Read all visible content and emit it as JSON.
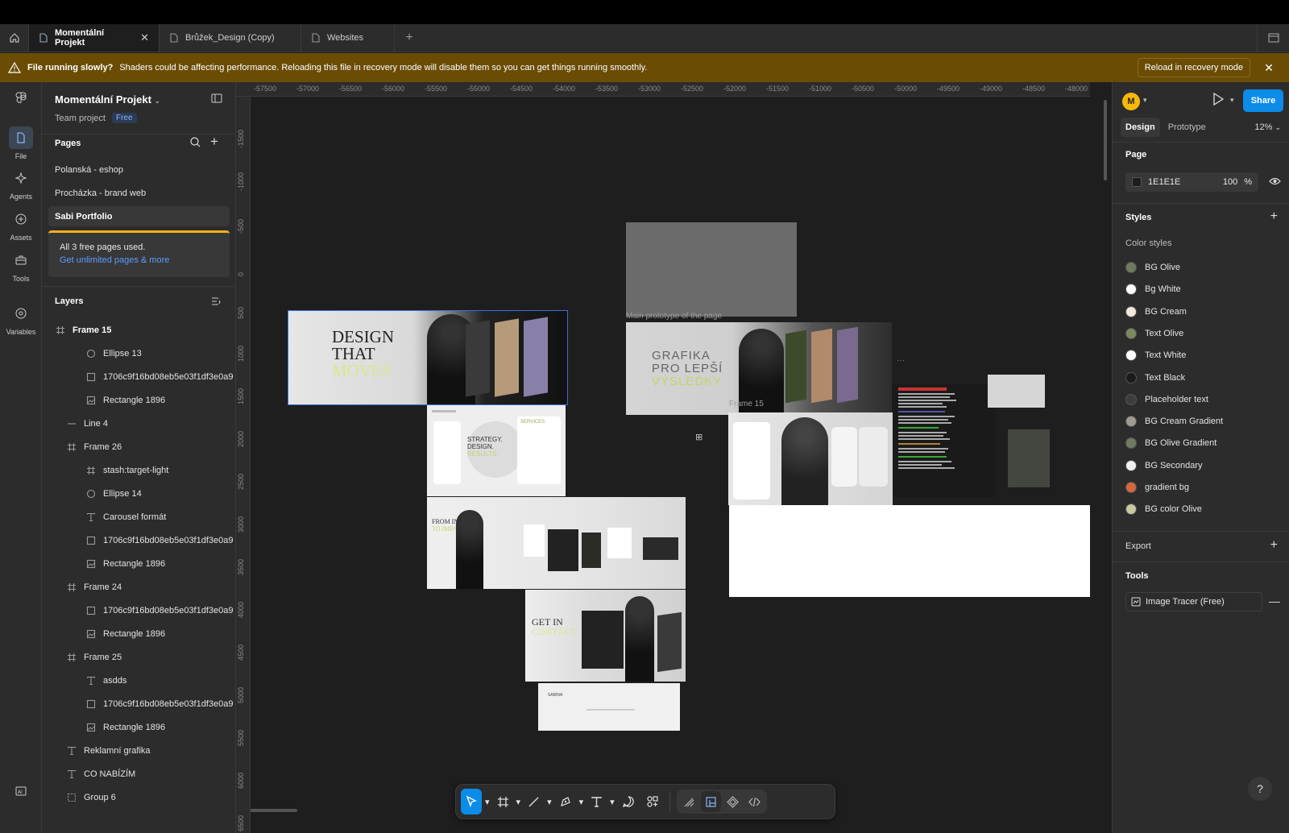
{
  "tabs": {
    "items": [
      {
        "label": "Momentální Projekt",
        "active": true
      },
      {
        "label": "Brůžek_Design (Copy)",
        "active": false
      },
      {
        "label": "Websites",
        "active": false
      }
    ]
  },
  "banner": {
    "title": "File running slowly?",
    "message": "Shaders could be affecting performance. Reloading this file in recovery mode will disable them so you can get things running smoothly.",
    "button": "Reload in recovery mode"
  },
  "rail": {
    "items": [
      {
        "label": "File",
        "icon": "file-icon"
      },
      {
        "label": "Agents",
        "icon": "agents-icon"
      },
      {
        "label": "Assets",
        "icon": "assets-icon"
      },
      {
        "label": "Tools",
        "icon": "tools-icon"
      },
      {
        "label": "Variables",
        "icon": "variables-icon"
      }
    ]
  },
  "project": {
    "name": "Momentální Projekt",
    "team": "Team project",
    "plan": "Free"
  },
  "pages": {
    "title": "Pages",
    "items": [
      "Polanská - eshop",
      "Procházka - brand web",
      "Sabi Portfolio"
    ],
    "notice_text": "All 3 free pages used.",
    "notice_link": "Get unlimited pages & more"
  },
  "layers": {
    "title": "Layers",
    "items": [
      {
        "name": "Frame 15",
        "type": "frame",
        "bold": true
      },
      {
        "name": "Ellipse 13",
        "type": "ellipse"
      },
      {
        "name": "1706c9f16bd08eb5e03f1df3e0a9",
        "type": "rect"
      },
      {
        "name": "Rectangle 1896",
        "type": "image"
      },
      {
        "name": "Line 4",
        "type": "line"
      },
      {
        "name": "Frame 26",
        "type": "frame"
      },
      {
        "name": "stash:target-light",
        "type": "frame"
      },
      {
        "name": "Ellipse 14",
        "type": "ellipse"
      },
      {
        "name": "Carousel formát",
        "type": "text"
      },
      {
        "name": "1706c9f16bd08eb5e03f1df3e0a9",
        "type": "rect"
      },
      {
        "name": "Rectangle 1896",
        "type": "image"
      },
      {
        "name": "Frame 24",
        "type": "frame"
      },
      {
        "name": "1706c9f16bd08eb5e03f1df3e0a9",
        "type": "rect"
      },
      {
        "name": "Rectangle 1896",
        "type": "image"
      },
      {
        "name": "Frame 25",
        "type": "frame"
      },
      {
        "name": "asdds",
        "type": "text"
      },
      {
        "name": "1706c9f16bd08eb5e03f1df3e0a9",
        "type": "rect"
      },
      {
        "name": "Rectangle 1896",
        "type": "image"
      },
      {
        "name": "Reklamní grafika",
        "type": "text"
      },
      {
        "name": "CO NABÍZÍM",
        "type": "text"
      },
      {
        "name": "Group 6",
        "type": "group"
      }
    ]
  },
  "ruler": {
    "top": [
      "-57500",
      "-57000",
      "-56500",
      "-56000",
      "-55500",
      "-55000",
      "-54500",
      "-54000",
      "-53500",
      "-53000",
      "-52500",
      "-52000",
      "-51500",
      "-51000",
      "-50500",
      "-50000",
      "-49500",
      "-49000",
      "-48500",
      "-48000"
    ],
    "left": [
      "-1500",
      "-1000",
      "-500",
      "0",
      "500",
      "1000",
      "1500",
      "2000",
      "2500",
      "3000",
      "3500",
      "4000",
      "4500",
      "5000",
      "5500",
      "6000",
      "6500"
    ]
  },
  "canvas": {
    "label_main_prototype": "Main prototype of the page",
    "label_frame15": "Frame 15",
    "hero1": {
      "l1": "DESIGN",
      "l2": "THAT",
      "l3": "MOVES"
    },
    "hero2": {
      "l1": "GRAFIKA",
      "l2": "PRO LEPŠÍ",
      "l3": "VÝSLEDKY"
    },
    "strategy": {
      "l1": "STRATEGY.",
      "l2": "DESIGN.",
      "l3": "RESULTS."
    },
    "services_label": "SERVICES",
    "from_input": {
      "l1": "FROM INPUT",
      "l2": "TO IMPACT"
    },
    "contact": {
      "l1": "GET IN",
      "l2": "CONTACT"
    },
    "brand": "SABINA"
  },
  "toolbar": {
    "tools": [
      "move-tool",
      "frame-tool",
      "line-tool",
      "pen-tool",
      "text-tool",
      "comment-tool",
      "actions-tool"
    ],
    "modes": [
      "draw-mode",
      "design-mode",
      "prototype-mode",
      "dev-mode"
    ]
  },
  "right": {
    "avatar": "M",
    "share": "Share",
    "tabs": [
      "Design",
      "Prototype"
    ],
    "zoom": "12%",
    "page_title": "Page",
    "page_color": "1E1E1E",
    "page_opacity": "100",
    "page_opacity_unit": "%",
    "styles_title": "Styles",
    "color_styles_title": "Color styles",
    "color_styles": [
      {
        "name": "BG Olive",
        "color": "#6f7a5e"
      },
      {
        "name": "Bg White",
        "color": "#ffffff"
      },
      {
        "name": "BG Cream",
        "color": "#f2e8da"
      },
      {
        "name": "Text Olive",
        "color": "#7a8a5c"
      },
      {
        "name": "Text White",
        "color": "#ffffff"
      },
      {
        "name": "Text Black",
        "color": "#1a1a1a"
      },
      {
        "name": "Placeholder text",
        "color": "#3d3d3d"
      },
      {
        "name": "BG Cream Gradient",
        "color": "#a19a90"
      },
      {
        "name": "BG Olive Gradient",
        "color": "#6f7a5e"
      },
      {
        "name": "BG Secondary",
        "color": "#f0f0f0"
      },
      {
        "name": "gradient bg",
        "color": "#d4683a"
      },
      {
        "name": "BG color Olive",
        "color": "#c7caa0"
      }
    ],
    "export_title": "Export",
    "tools_title": "Tools",
    "tool_item": "Image Tracer (Free)"
  }
}
